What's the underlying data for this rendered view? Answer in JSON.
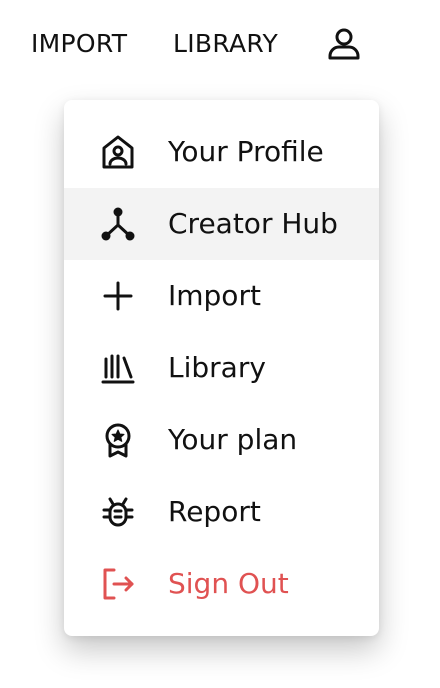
{
  "header": {
    "nav_import": "IMPORT",
    "nav_library": "LIBRARY",
    "account_icon": "user-icon"
  },
  "menu": {
    "highlighted_index": 1,
    "items": [
      {
        "label": "Your Profile",
        "icon": "profile-icon"
      },
      {
        "label": "Creator Hub",
        "icon": "creator-hub-icon"
      },
      {
        "label": "Import",
        "icon": "plus-icon"
      },
      {
        "label": "Library",
        "icon": "library-icon"
      },
      {
        "label": "Your plan",
        "icon": "award-badge-icon"
      },
      {
        "label": "Report",
        "icon": "bug-icon"
      },
      {
        "label": "Sign Out",
        "icon": "sign-out-icon"
      }
    ]
  },
  "colors": {
    "text": "#111111",
    "danger": "#e05252",
    "highlight_bg": "#f3f3f3"
  }
}
